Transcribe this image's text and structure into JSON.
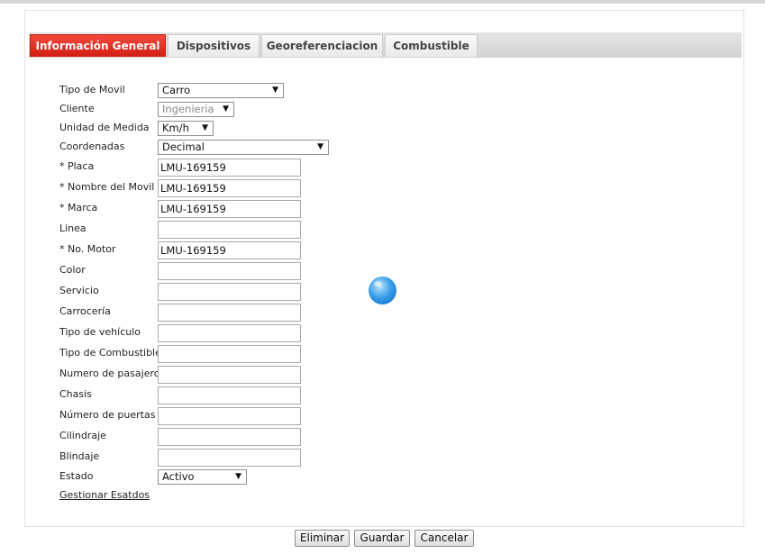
{
  "tabs": [
    {
      "label": "Información General"
    },
    {
      "label": "Dispositivos"
    },
    {
      "label": "Georeferenciacion"
    },
    {
      "label": "Combustible"
    }
  ],
  "form": {
    "tipo_movil": {
      "label": "Tipo de Movil",
      "value": "Carro"
    },
    "cliente": {
      "label": "Cliente",
      "value": "Ingenieria"
    },
    "unidad_medida": {
      "label": "Unidad de Medida",
      "value": "Km/h"
    },
    "coordenadas": {
      "label": "Coordenadas",
      "value": "Decimal"
    },
    "placa": {
      "label": "* Placa",
      "value": "LMU-169159"
    },
    "nombre_movil": {
      "label": "* Nombre del Movil",
      "value": "LMU-169159"
    },
    "marca": {
      "label": "* Marca",
      "value": "LMU-169159"
    },
    "linea": {
      "label": "Linea",
      "value": ""
    },
    "no_motor": {
      "label": "* No. Motor",
      "value": "LMU-169159"
    },
    "color": {
      "label": "Color",
      "value": ""
    },
    "servicio": {
      "label": "Servicio",
      "value": ""
    },
    "carroceria": {
      "label": "Carrocería",
      "value": ""
    },
    "tipo_vehiculo": {
      "label": "Tipo de vehículo",
      "value": ""
    },
    "tipo_combustible": {
      "label": "Tipo de Combustible",
      "value": ""
    },
    "numero_pasajeros": {
      "label": "Numero de pasajeros",
      "value": ""
    },
    "chasis": {
      "label": "Chasis",
      "value": ""
    },
    "numero_puertas": {
      "label": "Número de puertas",
      "value": ""
    },
    "cilindraje": {
      "label": "Cilindraje",
      "value": ""
    },
    "blindaje": {
      "label": "Blindaje",
      "value": ""
    },
    "estado": {
      "label": "Estado",
      "value": "Activo"
    }
  },
  "gestionar_link": "Gestionar Esatdos",
  "buttons": {
    "eliminar": "Eliminar",
    "guardar": "Guardar",
    "cancelar": "Cancelar"
  },
  "icons": {
    "dropdown_arrow": "▼",
    "loading": "loading-globe-icon"
  },
  "colors": {
    "active_tab": "#e0261b",
    "loading_globe": "#2a8ee6"
  }
}
